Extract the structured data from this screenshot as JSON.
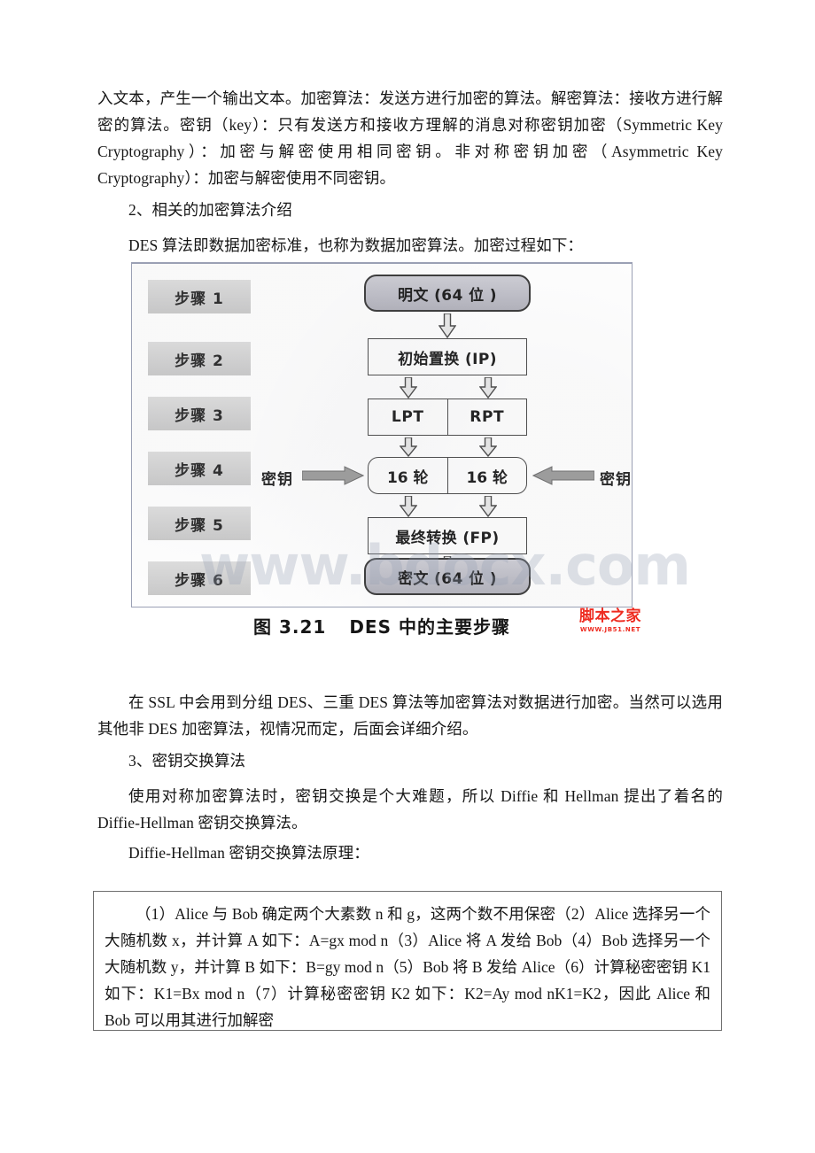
{
  "document": {
    "paragraphs": [
      {
        "id": "p-intro",
        "text": "入文本，产生一个输出文本。加密算法：发送方进行加密的算法。解密算法：接收方进行解密的算法。密钥（key）：只有发送方和接收方理解的消息对称密钥加密（Symmetric Key Cryptography）：加密与解密使用相同密钥。非对称密钥加密（Asymmetric Key Cryptography）：加密与解密使用不同密钥。"
      },
      {
        "id": "p-heading-2",
        "text": "2、相关的加密算法介绍"
      },
      {
        "id": "p-des-intro",
        "text": "DES 算法即数据加密标准，也称为数据加密算法。加密过程如下："
      },
      {
        "id": "p-ssl",
        "text": "在 SSL 中会用到分组 DES、三重 DES 算法等加密算法对数据进行加密。当然可以选用其他非 DES 加密算法，视情况而定，后面会详细介绍。"
      },
      {
        "id": "p-heading-3",
        "text": "3、密钥交换算法"
      },
      {
        "id": "p-dh-intro",
        "text": "使用对称加密算法时，密钥交换是个大难题，所以 Diffie 和 Hellman 提出了着名的 Diffie-Hellman 密钥交换算法。"
      },
      {
        "id": "p-dh-principle",
        "text": "Diffie-Hellman 密钥交换算法原理："
      }
    ]
  },
  "figure": {
    "caption_number": "图 3.21",
    "caption_title": "DES 中的主要步骤",
    "watermark": "www.bdocx.com",
    "logo": {
      "name": "脚本之家",
      "url": "WWW.JB51.NET",
      "color": "#ee2b20"
    },
    "steps": [
      {
        "label": "步骤 1"
      },
      {
        "label": "步骤 2"
      },
      {
        "label": "步骤 3"
      },
      {
        "label": "步骤 4"
      },
      {
        "label": "步骤 5"
      },
      {
        "label": "步骤 6"
      }
    ],
    "nodes": {
      "plaintext": "明文 (64 位 )",
      "initial_permutation": "初始置换 (IP)",
      "lpt": "LPT",
      "rpt": "RPT",
      "rounds_left": "16 轮",
      "rounds_right": "16 轮",
      "final_permutation": "最终转换 (FP)",
      "ciphertext": "密文 (64 位 )"
    },
    "key_labels": {
      "left": "密钥",
      "right": "密钥"
    }
  },
  "dh_box": {
    "text": "（1）Alice 与 Bob 确定两个大素数 n 和 g，这两个数不用保密（2）Alice 选择另一个大随机数 x，并计算 A 如下：A=gx mod n（3）Alice 将 A 发给 Bob（4）Bob 选择另一个大随机数 y，并计算 B 如下：B=gy mod n（5）Bob 将 B 发给 Alice（6）计算秘密密钥 K1 如下：K1=Bx mod n（7）计算秘密密钥 K2 如下：K2=Ay mod nK1=K2，因此 Alice 和 Bob 可以用其进行加解密"
  }
}
